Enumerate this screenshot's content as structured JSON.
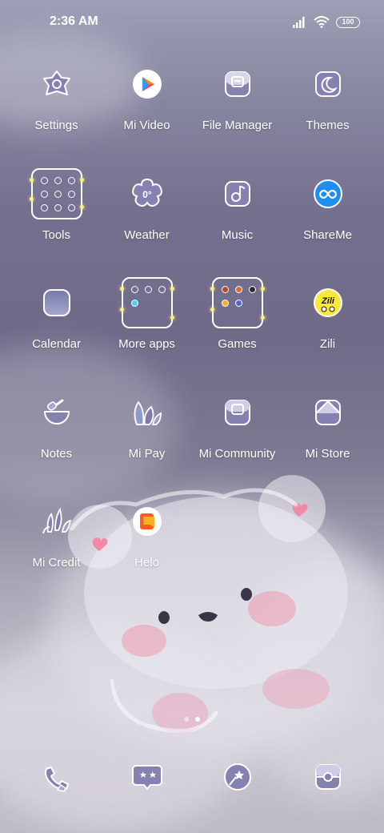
{
  "status_bar": {
    "time": "2:36 AM",
    "battery": "100"
  },
  "apps": [
    {
      "label": "Settings",
      "icon": "settings-icon"
    },
    {
      "label": "Mi Video",
      "icon": "mi-video-icon"
    },
    {
      "label": "File Manager",
      "icon": "file-manager-icon"
    },
    {
      "label": "Themes",
      "icon": "themes-icon"
    },
    {
      "label": "Tools",
      "icon": "tools-folder-icon"
    },
    {
      "label": "Weather",
      "icon": "weather-icon",
      "badge": "0°"
    },
    {
      "label": "Music",
      "icon": "music-icon"
    },
    {
      "label": "ShareMe",
      "icon": "shareme-icon"
    },
    {
      "label": "Calendar",
      "icon": "calendar-icon"
    },
    {
      "label": "More apps",
      "icon": "more-apps-folder-icon"
    },
    {
      "label": "Games",
      "icon": "games-folder-icon"
    },
    {
      "label": "Zili",
      "icon": "zili-icon",
      "badge": "Zili"
    },
    {
      "label": "Notes",
      "icon": "notes-icon"
    },
    {
      "label": "Mi Pay",
      "icon": "mi-pay-icon"
    },
    {
      "label": "Mi Community",
      "icon": "mi-community-icon"
    },
    {
      "label": "Mi Store",
      "icon": "mi-store-icon"
    },
    {
      "label": "Mi Credit",
      "icon": "mi-credit-icon"
    },
    {
      "label": "Helo",
      "icon": "helo-icon"
    }
  ],
  "dock": [
    {
      "icon": "phone-icon"
    },
    {
      "icon": "messages-icon"
    },
    {
      "icon": "browser-icon"
    },
    {
      "icon": "camera-icon"
    }
  ],
  "page_indicator": {
    "count": 2,
    "active": 2
  },
  "colors": {
    "icon_bg": "#7f7aa6",
    "icon_stroke": "#ffffff",
    "accent_yellow": "#f8f27a",
    "shareme_blue": "#1f8ef1",
    "helo_orange": "#ff5a1f"
  }
}
